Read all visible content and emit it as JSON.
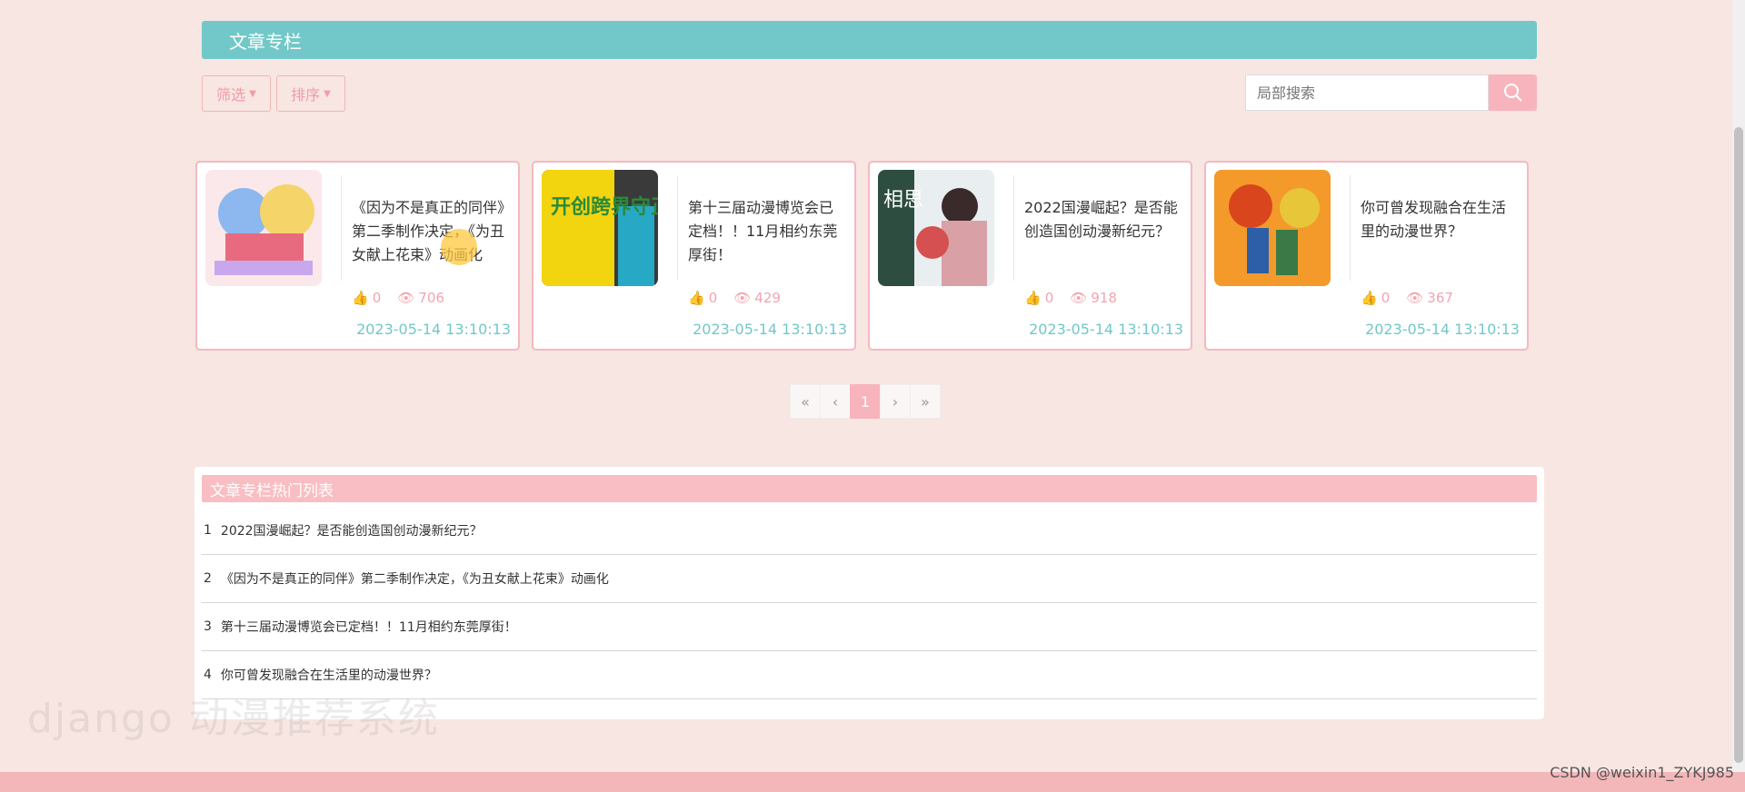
{
  "header": {
    "title": "文章专栏"
  },
  "filters": {
    "filter_label": "筛选",
    "sort_label": "排序"
  },
  "search": {
    "placeholder": "局部搜索"
  },
  "cards": [
    {
      "title": "《因为不是真正的同伴》第二季制作决定，《为丑女献上花束》动画化",
      "likes": "0",
      "views": "706",
      "date": "2023-05-14 13:10:13"
    },
    {
      "title": "第十三届动漫博览会已定档！！11月相约东莞厚街！",
      "likes": "0",
      "views": "429",
      "date": "2023-05-14 13:10:13"
    },
    {
      "title": "2022国漫崛起？是否能创造国创动漫新纪元？",
      "likes": "0",
      "views": "918",
      "date": "2023-05-14 13:10:13"
    },
    {
      "title": "你可曾发现融合在生活里的动漫世界？",
      "likes": "0",
      "views": "367",
      "date": "2023-05-14 13:10:13"
    }
  ],
  "thumbs": {
    "card2_text": "开创跨界守正",
    "card3_text": "相思"
  },
  "pagination": {
    "first": "«",
    "prev": "‹",
    "current": "1",
    "next": "›",
    "last": "»"
  },
  "hot": {
    "title": "文章专栏热门列表",
    "items": [
      {
        "idx": "1",
        "text": "2022国漫崛起？是否能创造国创动漫新纪元？"
      },
      {
        "idx": "2",
        "text": "《因为不是真正的同伴》第二季制作决定，《为丑女献上花束》动画化"
      },
      {
        "idx": "3",
        "text": "第十三届动漫博览会已定档！！11月相约东莞厚街！"
      },
      {
        "idx": "4",
        "text": "你可曾发现融合在生活里的动漫世界？"
      }
    ]
  },
  "watermark": "django 动漫推荐系统",
  "csdn": "CSDN @weixin1_ZYKJ985",
  "colors": {
    "accent_teal": "#72c8c8",
    "accent_pink": "#f8b4bd",
    "background": "#f7e6e2"
  }
}
